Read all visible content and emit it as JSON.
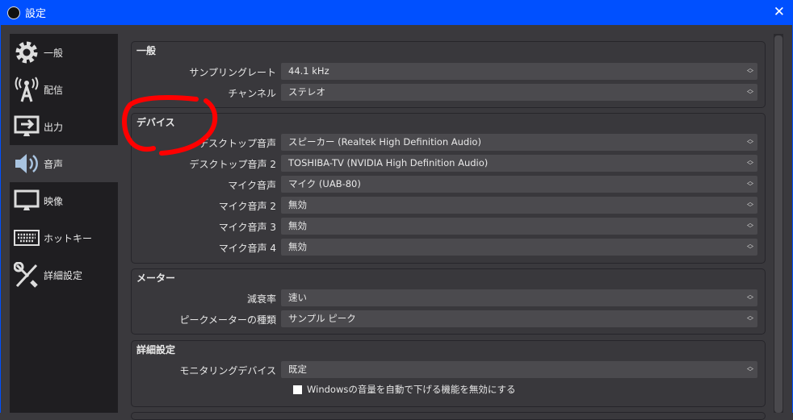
{
  "window": {
    "title": "設定",
    "close": "✕"
  },
  "sidebar": {
    "items": [
      {
        "label": "一般",
        "icon": "gear-icon"
      },
      {
        "label": "配信",
        "icon": "broadcast-icon"
      },
      {
        "label": "出力",
        "icon": "output-icon"
      },
      {
        "label": "音声",
        "icon": "speaker-icon",
        "active": true
      },
      {
        "label": "映像",
        "icon": "monitor-icon"
      },
      {
        "label": "ホットキー",
        "icon": "keyboard-icon"
      },
      {
        "label": "詳細設定",
        "icon": "tools-icon"
      }
    ]
  },
  "general": {
    "title": "一般",
    "rows": [
      {
        "label": "サンプリングレート",
        "value": "44.1 kHz"
      },
      {
        "label": "チャンネル",
        "value": "ステレオ"
      }
    ]
  },
  "devices": {
    "title": "デバイス",
    "rows": [
      {
        "label": "デスクトップ音声",
        "value": "スピーカー (Realtek High Definition Audio)"
      },
      {
        "label": "デスクトップ音声 2",
        "value": "TOSHIBA-TV (NVIDIA High Definition Audio)"
      },
      {
        "label": "マイク音声",
        "value": "マイク (UAB-80)"
      },
      {
        "label": "マイク音声 2",
        "value": "無効"
      },
      {
        "label": "マイク音声 3",
        "value": "無効"
      },
      {
        "label": "マイク音声 4",
        "value": "無効"
      }
    ]
  },
  "meter": {
    "title": "メーター",
    "rows": [
      {
        "label": "減衰率",
        "value": "速い"
      },
      {
        "label": "ピークメーターの種類",
        "value": "サンプル ピーク"
      }
    ]
  },
  "advanced": {
    "title": "詳細設定",
    "rows": [
      {
        "label": "モニタリングデバイス",
        "value": "既定"
      }
    ],
    "checkbox": {
      "label": "Windowsの音量を自動で下げる機能を無効にする",
      "checked": false
    }
  },
  "annotation_color": "#ff0000"
}
